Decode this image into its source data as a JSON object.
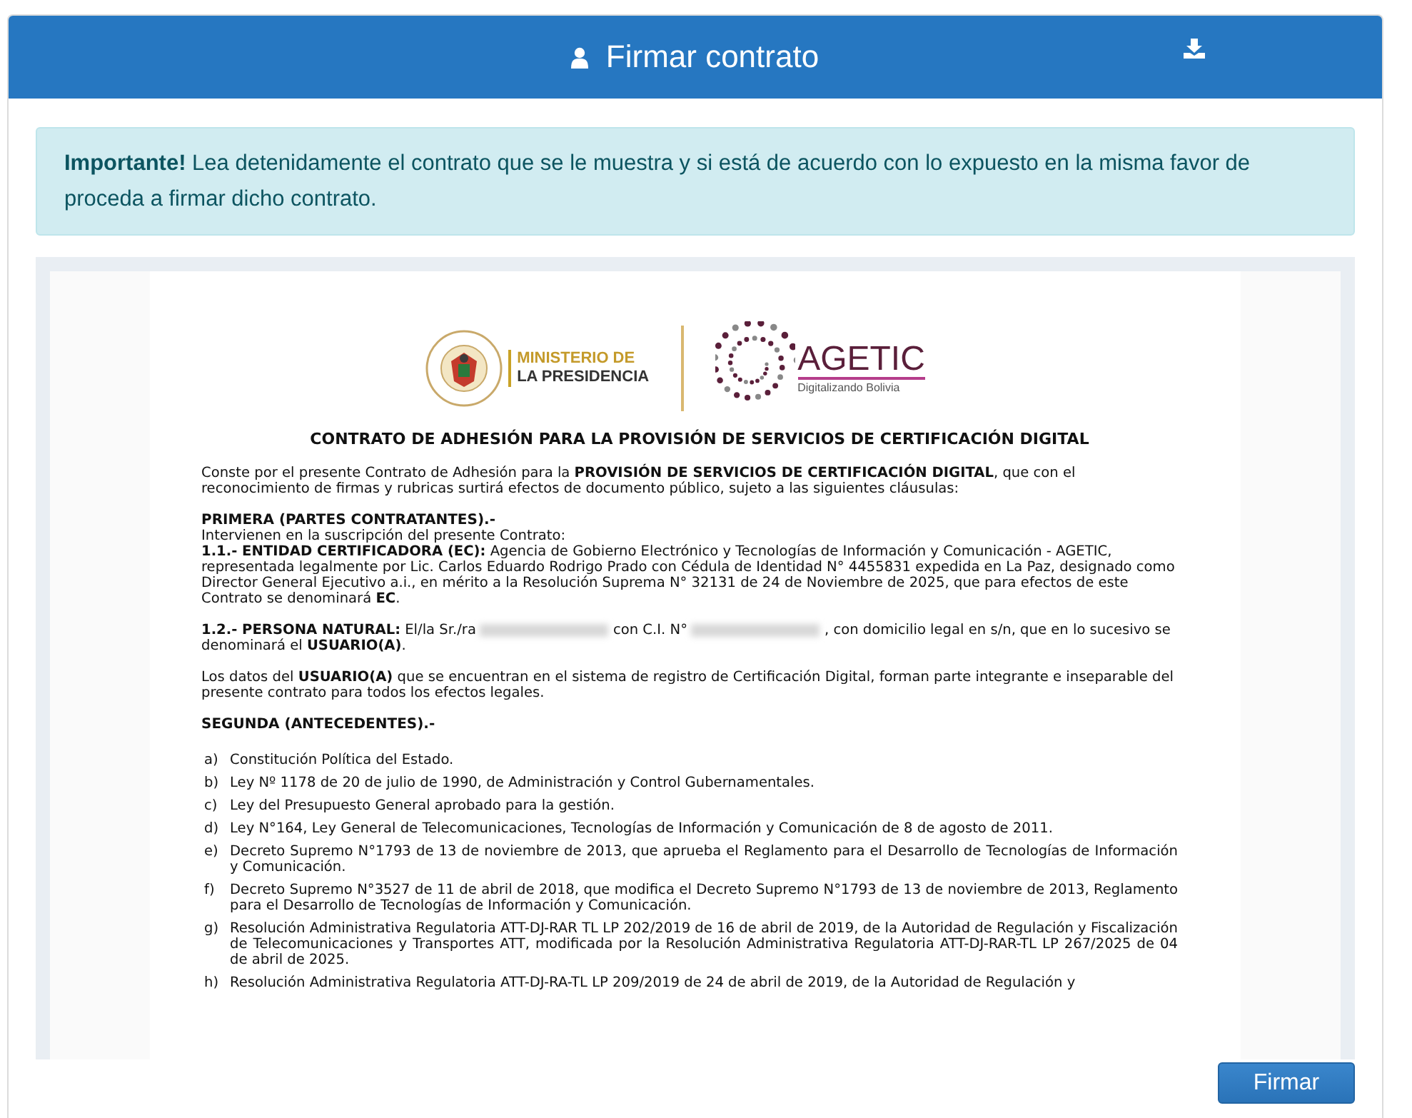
{
  "header": {
    "title": "Firmar contrato"
  },
  "alert": {
    "text": "**Importante!** Lea detenidamente el contrato que se le muestra y si está de acuerdo con lo expuesto en la misma favor de proceda a firmar dicho contrato."
  },
  "document": {
    "logos": {
      "ministry_line_1": "MINISTERIO DE",
      "ministry_line_2": "LA PRESIDENCIA",
      "agetic_name": "AGETIC",
      "agetic_tagline": "Digitalizando Bolivia"
    },
    "title": "CONTRATO DE ADHESIÓN PARA LA PROVISIÓN DE SERVICIOS DE CERTIFICACIÓN DIGITAL",
    "blocks": [
      {
        "kind": "paragraph",
        "text": "Conste por el presente Contrato de Adhesión para la **PROVISIÓN DE SERVICIOS DE CERTIFICACIÓN DIGITAL**, que con el reconocimiento de firmas y rubricas surtirá efectos de documento público, sujeto a las siguientes cláusulas:"
      },
      {
        "kind": "heading",
        "text": "PRIMERA (PARTES CONTRATANTES).-"
      },
      {
        "kind": "line",
        "text": "Intervienen en la suscripción del presente Contrato:"
      },
      {
        "kind": "paragraph",
        "text": "**1.1.- ENTIDAD CERTIFICADORA (EC):** Agencia de Gobierno Electrónico y Tecnologías de Información y Comunicación - AGETIC, representada legalmente por Lic. Carlos Eduardo Rodrigo Prado con Cédula de Identidad N° 4455831 expedida en La Paz, designado como Director General Ejecutivo a.i., en mérito a la Resolución Suprema N° 32131 de 24 de Noviembre de 2025, que para efectos de este Contrato se denominará **EC**."
      },
      {
        "kind": "redacted_paragraph",
        "parts": [
          {
            "kind": "text",
            "text": "**1.2.- PERSONA NATURAL:** El/la Sr./ra"
          },
          {
            "kind": "redacted"
          },
          {
            "kind": "text",
            "text": "con C.I. N°"
          },
          {
            "kind": "redacted"
          },
          {
            "kind": "text",
            "text": ", con domicilio legal en s/n, que en lo sucesivo se denominará el **USUARIO(A)**."
          }
        ]
      },
      {
        "kind": "paragraph",
        "text": "Los datos del **USUARIO(A)** que se encuentran en el sistema de registro de Certificación Digital, forman parte integrante e inseparable del presente contrato para todos los efectos legales."
      },
      {
        "kind": "heading",
        "text": "SEGUNDA (ANTECEDENTES).-"
      },
      {
        "kind": "list_item",
        "marker": "a)",
        "text": "Constitución Política del Estado."
      },
      {
        "kind": "list_item",
        "marker": "b)",
        "text": "Ley Nº 1178 de 20 de julio de 1990, de Administración y Control Gubernamentales."
      },
      {
        "kind": "list_item",
        "marker": "c)",
        "text": "Ley del Presupuesto General aprobado para la gestión."
      },
      {
        "kind": "list_item",
        "marker": "d)",
        "text": "Ley N°164, Ley General de Telecomunicaciones, Tecnologías de Información y Comunicación de 8 de agosto de 2011."
      },
      {
        "kind": "list_item",
        "marker": "e)",
        "text": "Decreto Supremo N°1793 de 13 de noviembre de 2013, que aprueba el Reglamento para el Desarrollo de Tecnologías de Información y Comunicación."
      },
      {
        "kind": "list_item",
        "marker": "f)",
        "text": "Decreto Supremo N°3527 de 11 de abril de 2018, que modifica el Decreto Supremo N°1793 de 13 de noviembre de 2013, Reglamento para el Desarrollo de Tecnologías de Información y Comunicación."
      },
      {
        "kind": "list_item",
        "marker": "g)",
        "text": "Resolución Administrativa Regulatoria ATT-DJ-RAR TL LP 202/2019 de 16 de abril de 2019, de la Autoridad de Regulación y Fiscalización de Telecomunicaciones y Transportes ATT, modificada por la Resolución Administrativa Regulatoria ATT-DJ-RAR-TL LP 267/2025 de 04 de abril de 2025."
      },
      {
        "kind": "list_item",
        "marker": "h)",
        "text": "Resolución Administrativa Regulatoria ATT-DJ-RA-TL LP 209/2019 de 24 de abril de 2019, de la Autoridad de Regulación y"
      }
    ]
  },
  "sign_button": {
    "label": "Firmar"
  }
}
